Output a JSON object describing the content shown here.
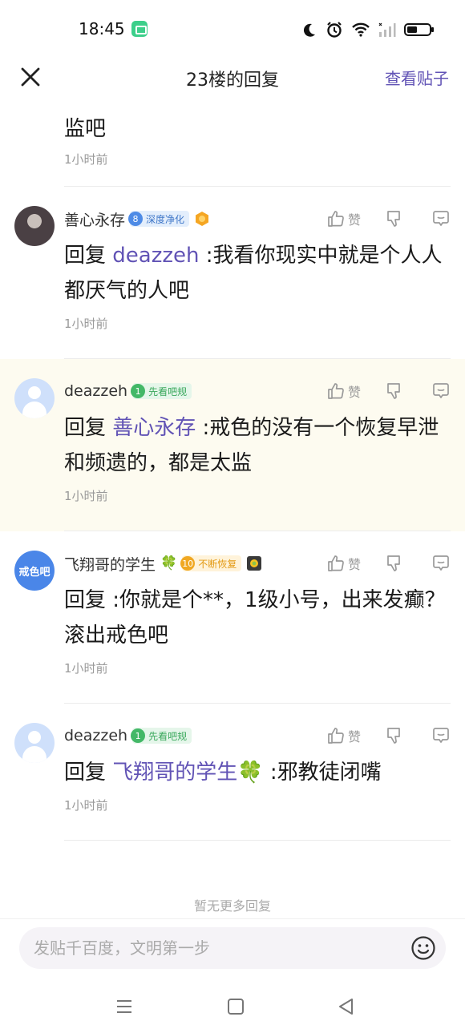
{
  "status_bar": {
    "time": "18:45"
  },
  "header": {
    "title": "23楼的回复",
    "view_post": "查看贴子"
  },
  "top_tail": {
    "text": "监吧",
    "time": "1小时前"
  },
  "replies": [
    {
      "username": "善心永存",
      "level": "8",
      "badge": "深度净化",
      "reply_prefix": "回复 ",
      "mention": "deazzeh",
      "text": " :我看你现实中就是个人人都厌气的人吧",
      "time": "1小时前",
      "like_label": "赞"
    },
    {
      "username": "deazzeh",
      "level": "1",
      "badge": "先看吧规",
      "reply_prefix": "回复 ",
      "mention": "善心永存",
      "text": " :戒色的没有一个恢复早泄和频遗的，都是太监",
      "time": "1小时前",
      "like_label": "赞"
    },
    {
      "username": "飞翔哥的学生",
      "username_suffix": "🍀",
      "avatar_text": "戒色吧",
      "level": "10",
      "badge": "不断恢复",
      "reply_prefix": "回复 ",
      "mention": "",
      "text": " :你就是个**，1级小号，出来发癫？滚出戒色吧",
      "time": "1小时前",
      "like_label": "赞"
    },
    {
      "username": "deazzeh",
      "level": "1",
      "badge": "先看吧规",
      "reply_prefix": "回复 ",
      "mention": "飞翔哥的学生🍀",
      "text": " :邪教徒闭嘴",
      "time": "1小时前",
      "like_label": "赞"
    }
  ],
  "no_more": "暂无更多回复",
  "input": {
    "placeholder": "发贴千百度，文明第一步"
  },
  "colors": {
    "accent": "#6153b5",
    "highlight_bg": "#fdfbf0"
  }
}
